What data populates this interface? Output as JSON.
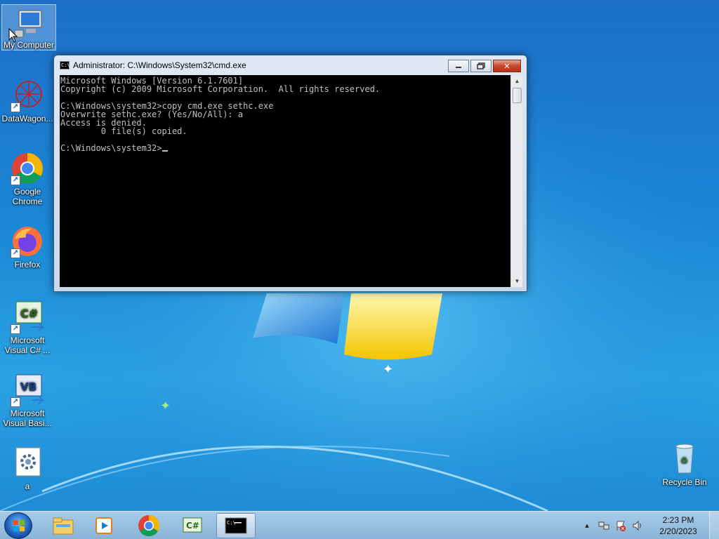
{
  "desktop": {
    "icons": [
      {
        "label": "My Computer",
        "name": "my-computer"
      },
      {
        "label": "DataWagon...",
        "name": "datawagon"
      },
      {
        "label": "Google Chrome",
        "name": "google-chrome"
      },
      {
        "label": "Firefox",
        "name": "firefox"
      },
      {
        "label": "Microsoft Visual C# ...",
        "name": "visual-csharp"
      },
      {
        "label": "Microsoft Visual Basi...",
        "name": "visual-basic"
      },
      {
        "label": "a",
        "name": "a-shortcut"
      },
      {
        "label": "Recycle Bin",
        "name": "recycle-bin"
      }
    ]
  },
  "cmd_window": {
    "title": "Administrator: C:\\Windows\\System32\\cmd.exe",
    "lines": [
      "Microsoft Windows [Version 6.1.7601]",
      "Copyright (c) 2009 Microsoft Corporation.  All rights reserved.",
      "",
      "C:\\Windows\\system32>copy cmd.exe sethc.exe",
      "Overwrite sethc.exe? (Yes/No/All): a",
      "Access is denied.",
      "        0 file(s) copied.",
      ""
    ],
    "prompt": "C:\\Windows\\system32>"
  },
  "taskbar": {
    "clock_time": "2:23 PM",
    "clock_date": "2/20/2023"
  }
}
